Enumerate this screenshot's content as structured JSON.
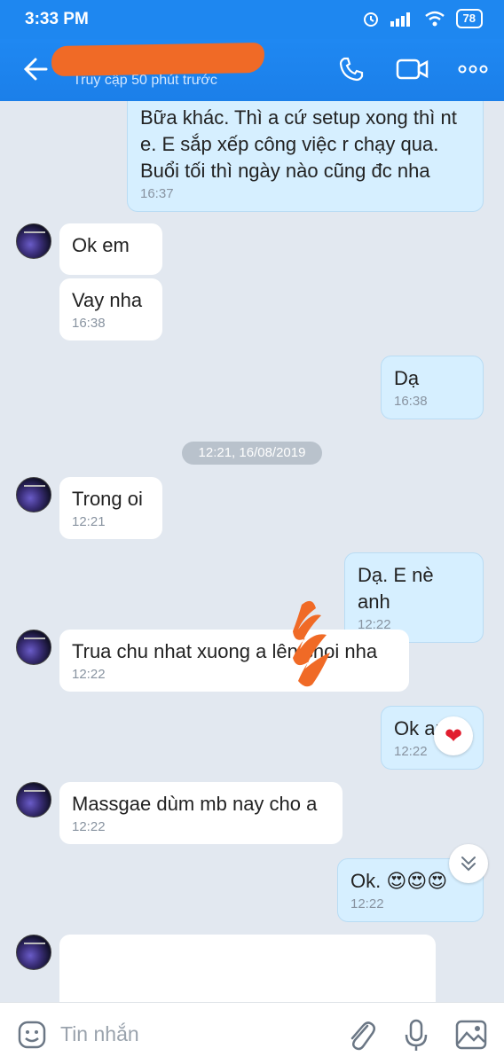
{
  "status": {
    "time": "3:33 PM",
    "battery": "78"
  },
  "header": {
    "subtitle": "Truy cập 50 phút trước"
  },
  "messages": [
    {
      "dir": "out",
      "text": "Bữa khác. Thì a cứ setup xong thì nt\ne. E sắp xếp công việc r chạy qua.\nBuổi tối thì ngày nào cũng đc nha",
      "time": "16:37"
    },
    {
      "dir": "in",
      "text": "Ok em",
      "time": ""
    },
    {
      "dir": "in",
      "text": "Vay nha",
      "time": "16:38"
    },
    {
      "dir": "out",
      "text": "Dạ",
      "time": "16:38"
    },
    {
      "dir": "in",
      "text": "Trong oi",
      "time": "12:21"
    },
    {
      "dir": "out",
      "text": "Dạ. E nè anh",
      "time": "12:22"
    },
    {
      "dir": "in",
      "text": "Trua chu nhat xuong a lên choi nha",
      "time": "12:22"
    },
    {
      "dir": "out",
      "text": "Ok anh",
      "time": "12:22"
    },
    {
      "dir": "in",
      "text": "Massgae dùm mb nay cho a",
      "time": "12:22"
    },
    {
      "dir": "out",
      "text": "Ok. 😍😍😍",
      "time": "12:22"
    }
  ],
  "date_separator": "12:21, 16/08/2019",
  "composer": {
    "placeholder": "Tin nhắn"
  },
  "icons": {
    "back": "arrow-left-icon",
    "call": "phone-icon",
    "video": "video-camera-icon",
    "more": "more-dots-icon",
    "emoji": "emoji-icon",
    "attach": "paperclip-icon",
    "mic": "microphone-icon",
    "image": "image-icon",
    "reaction": "heart-icon",
    "scroll": "chevron-double-down-icon"
  },
  "colors": {
    "header": "#1e87f0",
    "chat_bg": "#e2e8f0",
    "out_bubble": "#d6efff",
    "in_bubble": "#ffffff",
    "scribble": "#f06a26"
  }
}
